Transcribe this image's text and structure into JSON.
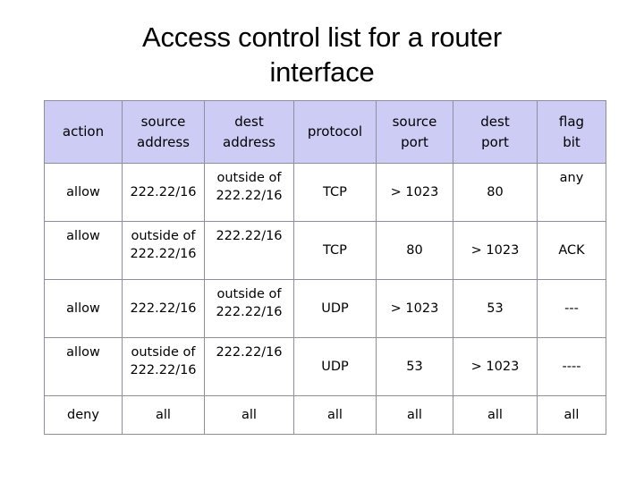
{
  "slide": {
    "title": "Access control list for a router\ninterface",
    "header_background": "#ccccf5",
    "border_color": "#3b3b3b",
    "text_color": "#000000"
  },
  "table": {
    "columns": [
      {
        "key": "action",
        "label": "action"
      },
      {
        "key": "saddr",
        "label": "source\naddress"
      },
      {
        "key": "daddr",
        "label": "dest\naddress"
      },
      {
        "key": "protocol",
        "label": "protocol"
      },
      {
        "key": "sport",
        "label": "source\nport"
      },
      {
        "key": "dport",
        "label": "dest\nport"
      },
      {
        "key": "flag",
        "label": "flag\nbit"
      }
    ],
    "rows": [
      {
        "action": "allow",
        "saddr": "222.22/16",
        "daddr": "outside of\n222.22/16",
        "protocol": "TCP",
        "sport": "> 1023",
        "dport": "80",
        "flag": "any"
      },
      {
        "action": "allow",
        "saddr": "outside of\n222.22/16",
        "daddr": "222.22/16",
        "protocol": "TCP",
        "sport": "80",
        "dport": "> 1023",
        "flag": "ACK"
      },
      {
        "action": "allow",
        "saddr": "222.22/16",
        "daddr": "outside of\n222.22/16",
        "protocol": "UDP",
        "sport": "> 1023",
        "dport": "53",
        "flag": "---"
      },
      {
        "action": "allow",
        "saddr": "outside of\n222.22/16",
        "daddr": "222.22/16",
        "protocol": "UDP",
        "sport": "53",
        "dport": "> 1023",
        "flag": "----"
      },
      {
        "action": "deny",
        "saddr": "all",
        "daddr": "all",
        "protocol": "all",
        "sport": "all",
        "dport": "all",
        "flag": "all"
      }
    ]
  }
}
